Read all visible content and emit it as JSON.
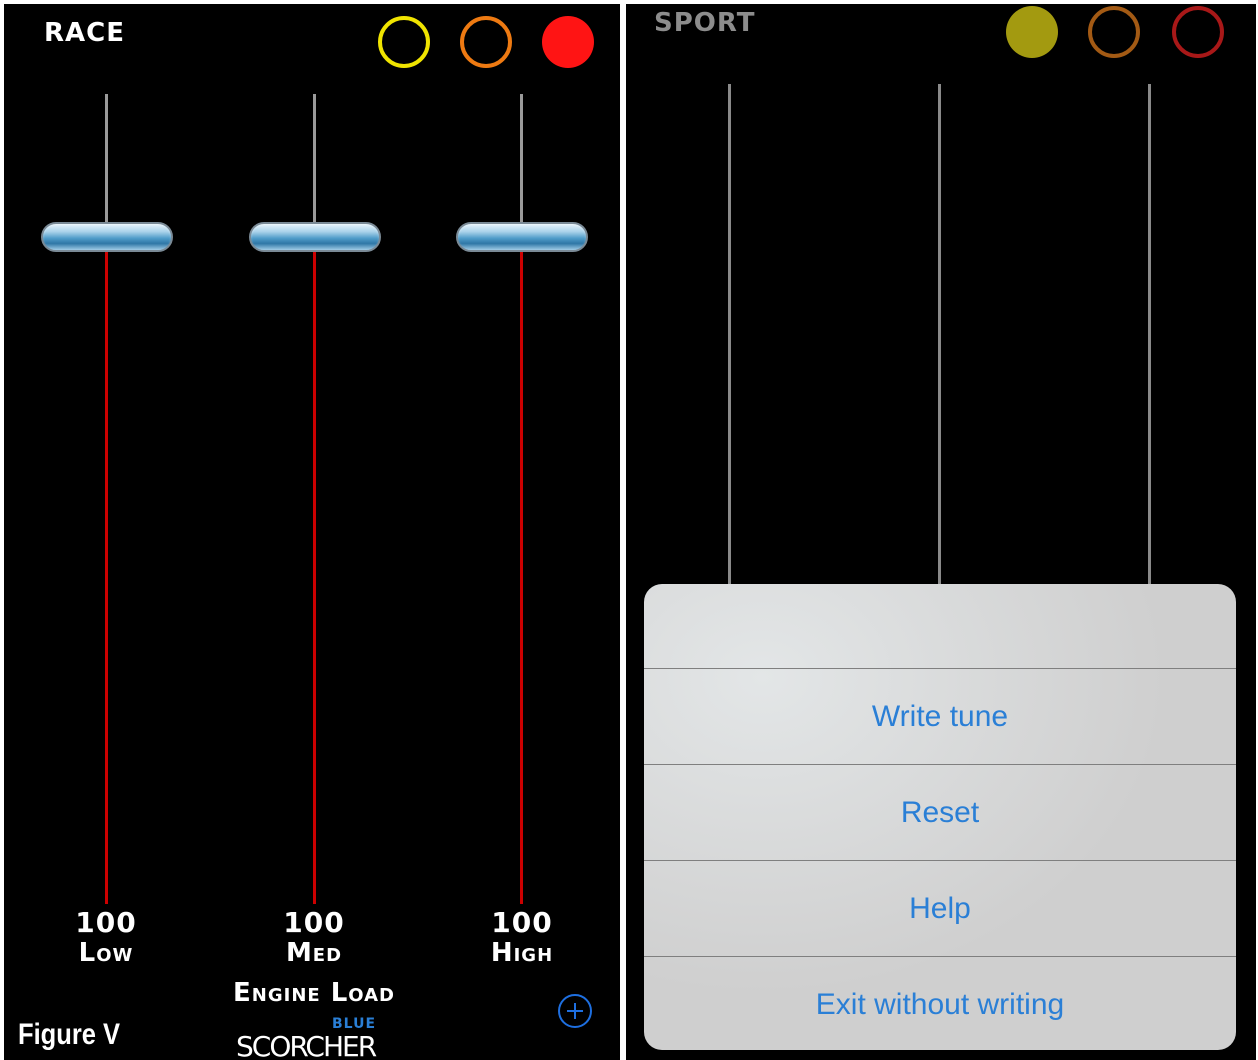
{
  "left_panel": {
    "mode_label": "RACE",
    "mode_circles": [
      {
        "name": "yellow-mode-circle",
        "color": "#f0e400",
        "filled": false
      },
      {
        "name": "orange-mode-circle",
        "color": "#ee7a12",
        "filled": false
      },
      {
        "name": "red-mode-circle",
        "color": "#ff1414",
        "filled": true
      }
    ],
    "sliders": [
      {
        "value": "100",
        "label": "Low"
      },
      {
        "value": "100",
        "label": "Med"
      },
      {
        "value": "100",
        "label": "High"
      }
    ],
    "slider_level_fraction": 0.79,
    "engine_load_label": "Engine Load",
    "logo_text": "SCORCHER",
    "logo_small_text": "BLUE",
    "add_icon": "plus-circle-icon"
  },
  "right_panel": {
    "mode_label": "SPORT",
    "mode_circles": [
      {
        "name": "yellow-mode-circle",
        "color": "#a39a10",
        "filled": true
      },
      {
        "name": "orange-mode-circle",
        "color": "#a35a14",
        "filled": false
      },
      {
        "name": "red-mode-circle",
        "color": "#a81818",
        "filled": false
      }
    ],
    "action_sheet": {
      "items": [
        "Write tune",
        "Reset",
        "Help",
        "Exit without writing"
      ],
      "text_color": "#2a7fd6"
    }
  },
  "figure_caption": "Figure V",
  "colors": {
    "background": "#000000",
    "active_track": "#cc0000",
    "inactive_track": "#9a9a9a",
    "accent_blue": "#1e6fe0"
  }
}
